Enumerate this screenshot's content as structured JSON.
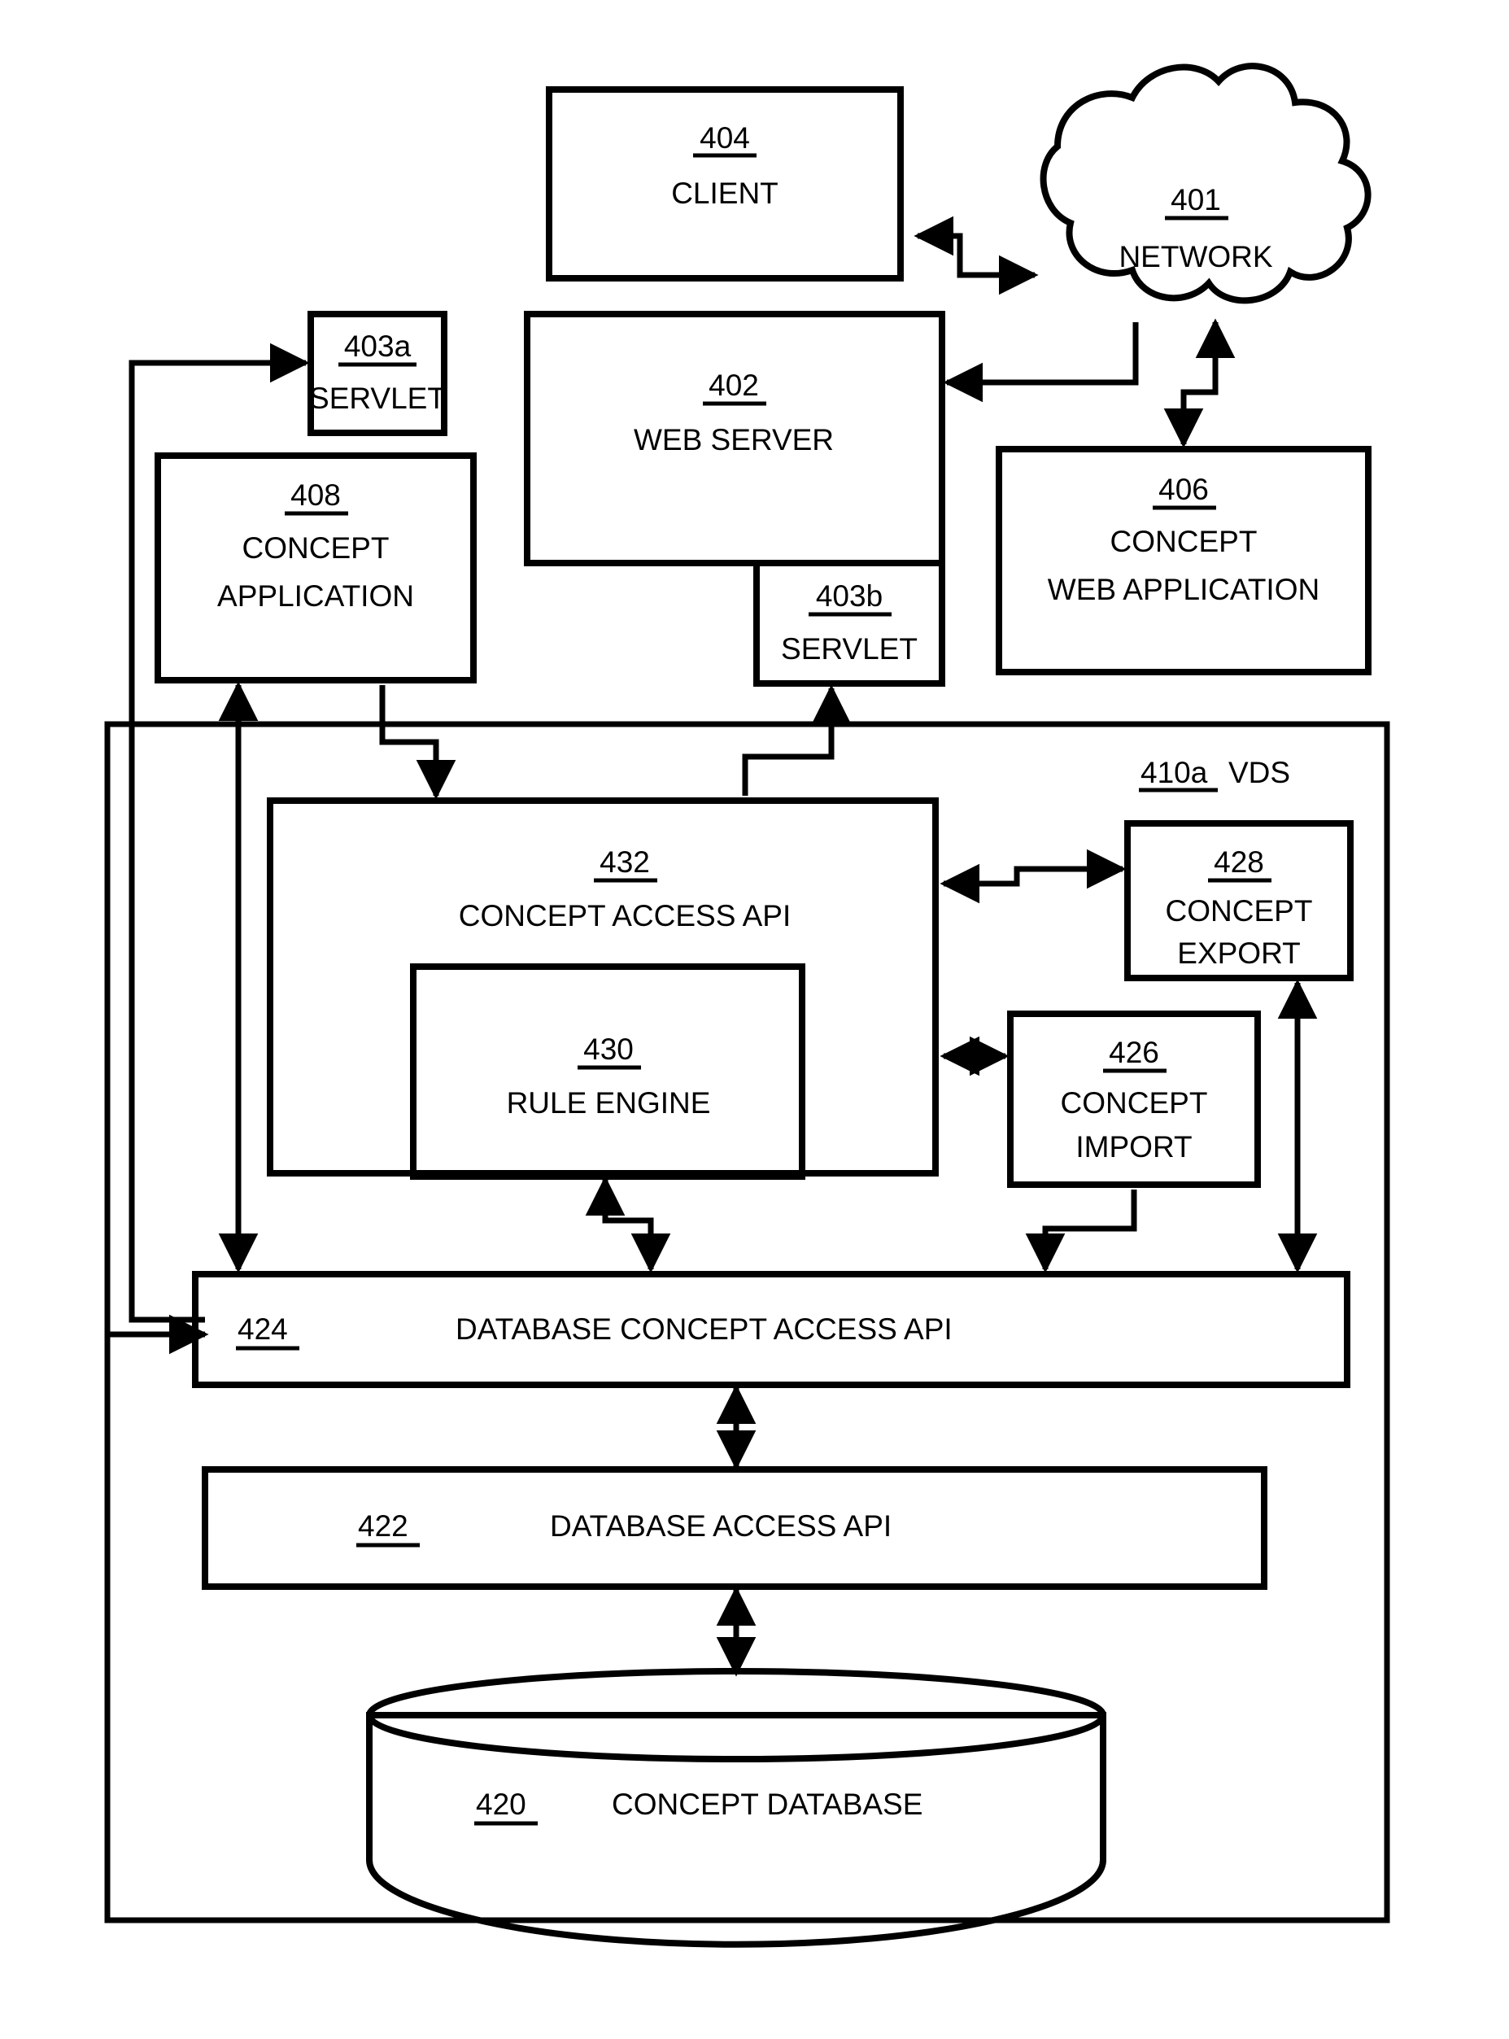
{
  "figure": {
    "type": "patent-block-diagram",
    "background": "#ffffff",
    "ink": "#000000"
  },
  "nodes": {
    "network": {
      "ref": "401",
      "label": "NETWORK",
      "shape": "cloud"
    },
    "client": {
      "ref": "404",
      "label": "CLIENT",
      "shape": "rect"
    },
    "web_server": {
      "ref": "402",
      "label": "WEB SERVER",
      "shape": "rect"
    },
    "servlet_a": {
      "ref": "403a",
      "label": "SERVLET",
      "shape": "rect"
    },
    "servlet_b": {
      "ref": "403b",
      "label": "SERVLET",
      "shape": "rect"
    },
    "concept_application": {
      "ref": "408",
      "label_line1": "CONCEPT",
      "label_line2": "APPLICATION",
      "shape": "rect"
    },
    "concept_web_application": {
      "ref": "406",
      "label_line1": "CONCEPT",
      "label_line2": "WEB APPLICATION",
      "shape": "rect"
    },
    "vds": {
      "ref": "410a",
      "label": "VDS",
      "shape": "container"
    },
    "concept_access_api": {
      "ref": "432",
      "label": "CONCEPT ACCESS  API",
      "shape": "rect"
    },
    "rule_engine": {
      "ref": "430",
      "label": "RULE ENGINE",
      "shape": "rect"
    },
    "concept_export": {
      "ref": "428",
      "label_line1": "CONCEPT",
      "label_line2": "EXPORT",
      "shape": "rect"
    },
    "concept_import": {
      "ref": "426",
      "label_line1": "CONCEPT",
      "label_line2": "IMPORT",
      "shape": "rect"
    },
    "database_concept_access_api": {
      "ref": "424",
      "label": "DATABASE CONCEPT ACCESS  API",
      "shape": "bar"
    },
    "database_access_api": {
      "ref": "422",
      "label": "DATABASE ACCESS  API",
      "shape": "bar"
    },
    "concept_database": {
      "ref": "420",
      "label": "CONCEPT DATABASE",
      "shape": "cylinder"
    }
  }
}
